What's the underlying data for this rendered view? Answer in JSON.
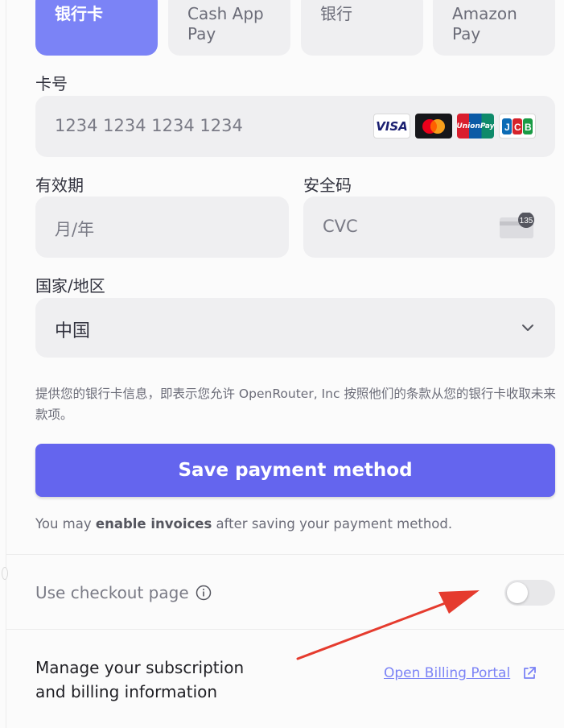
{
  "payment_methods": [
    {
      "label_line1": "银行卡",
      "label_line2": "",
      "active": true
    },
    {
      "label_line1": "Cash App",
      "label_line2": "Pay",
      "active": false
    },
    {
      "label_line1": "银行",
      "label_line2": "",
      "active": false
    },
    {
      "label_line1": "Amazon",
      "label_line2": "Pay",
      "active": false
    }
  ],
  "card_number": {
    "label": "卡号",
    "placeholder": "1234 1234 1234 1234",
    "brand_icons": [
      "visa-icon",
      "mastercard-icon",
      "unionpay-icon",
      "jcb-icon"
    ],
    "visa_text": "VISA",
    "unionpay_text": "UnionPay"
  },
  "expiry": {
    "label": "有效期",
    "placeholder": "月/年"
  },
  "cvc": {
    "label": "安全码",
    "placeholder": "CVC",
    "icon_badge": "135"
  },
  "country": {
    "label": "国家/地区",
    "value": "中国"
  },
  "consent_note": "提供您的银行卡信息，即表示您允许 OpenRouter, Inc 按照他们的条款从您的银行卡收取未来款项。",
  "save_button": "Save payment method",
  "invoice_note": {
    "prefix": "You may ",
    "bold": "enable invoices",
    "suffix": " after saving your payment method."
  },
  "checkout": {
    "label": "Use checkout page",
    "enabled": false
  },
  "billing": {
    "description": "Manage your subscription and billing information",
    "link": "Open Billing Portal"
  },
  "colors": {
    "accent": "#6465ee",
    "active_tab": "#7b83f6",
    "arrow": "#e53b2e"
  }
}
